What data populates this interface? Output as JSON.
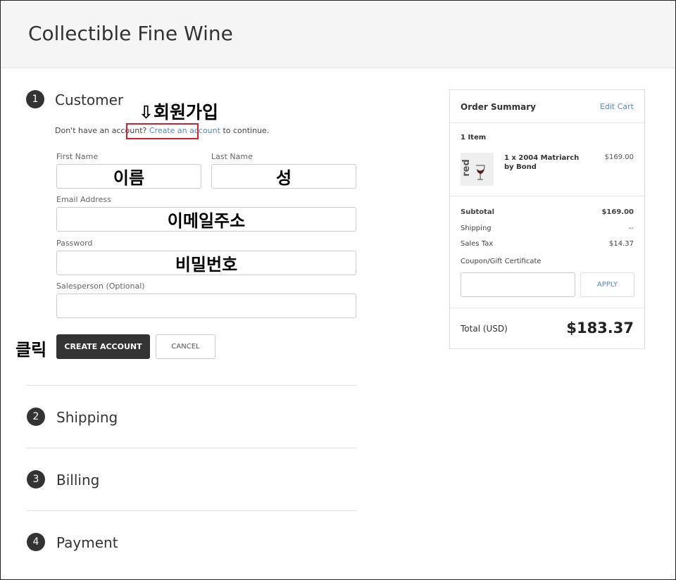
{
  "header": {
    "store_title": "Collectible Fine Wine"
  },
  "steps": [
    {
      "number": "1",
      "title": "Customer"
    },
    {
      "number": "2",
      "title": "Shipping"
    },
    {
      "number": "3",
      "title": "Billing"
    },
    {
      "number": "4",
      "title": "Payment"
    }
  ],
  "customer": {
    "hint_prefix": "Don't have an account? ",
    "create_link": "Create an account",
    "hint_suffix": " to continue.",
    "fields": {
      "first_name_label": "First Name",
      "last_name_label": "Last Name",
      "email_label": "Email Address",
      "password_label": "Password",
      "salesperson_label": "Salesperson (Optional)"
    },
    "create_button": "CREATE ACCOUNT",
    "cancel_button": "CANCEL"
  },
  "annotations": {
    "signup": "⇩회원가입",
    "first_name": "이름",
    "last_name": "성",
    "email": "이메일주소",
    "password": "비밀번호",
    "click": "클릭",
    "highlight_color": "#d21f2b"
  },
  "order_summary": {
    "title": "Order Summary",
    "edit_cart": "Edit Cart",
    "item_count": "1 Item",
    "item": {
      "thumb_text": "red",
      "name": "1 x 2004 Matriarch by Bond",
      "price": "$169.00"
    },
    "subtotal_label": "Subtotal",
    "subtotal_value": "$169.00",
    "shipping_label": "Shipping",
    "shipping_value": "--",
    "tax_label": "Sales Tax",
    "tax_value": "$14.37",
    "coupon_label": "Coupon/Gift Certificate",
    "apply_button": "APPLY",
    "total_label": "Total (USD)",
    "total_value": "$183.37"
  },
  "colors": {
    "accent_link": "#4f8bc9",
    "primary_button": "#333333"
  }
}
